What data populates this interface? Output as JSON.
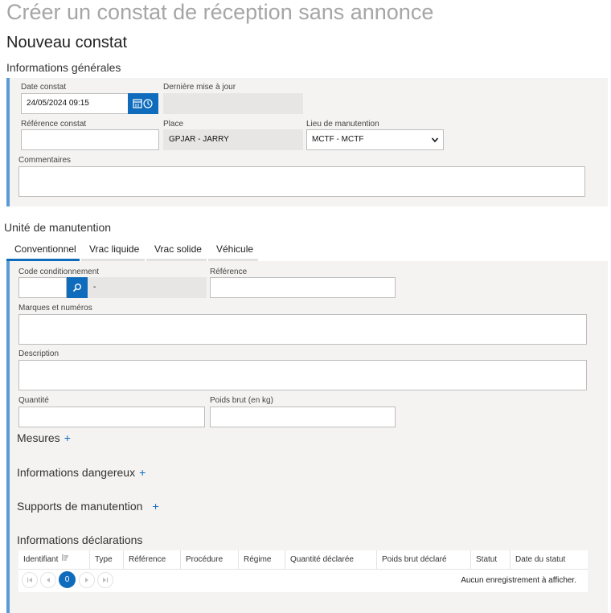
{
  "page": {
    "title": "Créer un constat de réception sans annonce",
    "subtitle": "Nouveau constat"
  },
  "general": {
    "section_title": "Informations générales",
    "date_constat": {
      "label": "Date constat",
      "value": "24/05/2024 09:15"
    },
    "derniere_maj": {
      "label": "Dernière mise à jour",
      "value": ""
    },
    "reference_constat": {
      "label": "Référence constat",
      "value": ""
    },
    "place": {
      "label": "Place",
      "value": "GPJAR - JARRY"
    },
    "lieu_manutention": {
      "label": "Lieu de manutention",
      "value": "MCTF - MCTF"
    },
    "commentaires": {
      "label": "Commentaires",
      "value": ""
    }
  },
  "unite": {
    "section_title": "Unité de manutention",
    "tabs": [
      {
        "label": "Conventionnel",
        "active": true
      },
      {
        "label": "Vrac liquide",
        "active": false
      },
      {
        "label": "Vrac solide",
        "active": false
      },
      {
        "label": "Véhicule",
        "active": false
      }
    ],
    "code_conditionnement": {
      "label": "Code conditionnement",
      "value": "",
      "description": "-"
    },
    "reference": {
      "label": "Référence",
      "value": ""
    },
    "marques": {
      "label": "Marques et numéros",
      "value": ""
    },
    "description": {
      "label": "Description",
      "value": ""
    },
    "quantite": {
      "label": "Quantité",
      "value": ""
    },
    "poids_brut": {
      "label": "Poids brut (en kg)",
      "value": ""
    },
    "mesures": {
      "label": "Mesures",
      "plus": "+"
    },
    "dangereux": {
      "label": "Informations dangereux",
      "plus": "+"
    },
    "supports": {
      "label": "Supports de manutention",
      "plus": "+"
    },
    "declarations": {
      "title": "Informations déclarations",
      "columns": [
        "Identifiant",
        "Type",
        "Référence",
        "Procédure",
        "Régime",
        "Quantité déclarée",
        "Poids brut déclaré",
        "Statut",
        "Date du statut"
      ],
      "current_page": "0",
      "empty_message": "Aucun enregistrement à afficher."
    }
  },
  "colors": {
    "accent": "#0f6cbd",
    "panel_bg": "#f4f3f1",
    "panel_border": "#5b9bd5",
    "readonly_bg": "#e7e6e4"
  }
}
